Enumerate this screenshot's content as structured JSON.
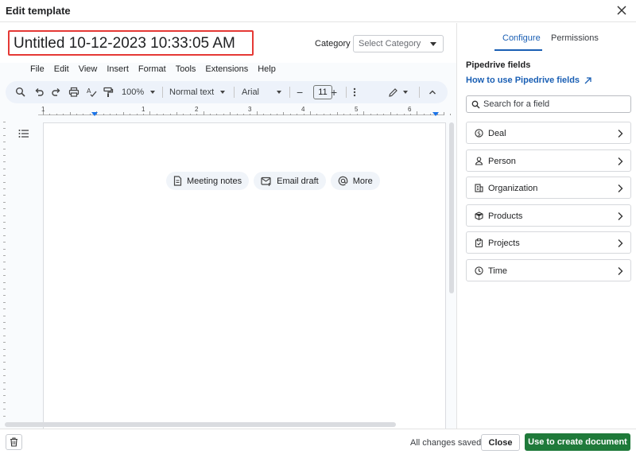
{
  "dialog": {
    "title": "Edit template",
    "close_icon": "close-icon"
  },
  "editor": {
    "document_title": "Untitled 10-12-2023 10:33:05 AM",
    "category_label": "Category",
    "category_placeholder": "Select Category",
    "menu": [
      "File",
      "Edit",
      "View",
      "Insert",
      "Format",
      "Tools",
      "Extensions",
      "Help"
    ],
    "toolbar": {
      "zoom": "100%",
      "style": "Normal text",
      "font": "Arial",
      "font_size": "11",
      "minus": "−",
      "plus": "+"
    },
    "ruler_numbers": [
      "1",
      "1",
      "2",
      "3",
      "4",
      "5",
      "6"
    ],
    "chips": [
      {
        "label": "Meeting notes",
        "icon": "document-icon"
      },
      {
        "label": "Email draft",
        "icon": "email-icon"
      },
      {
        "label": "More",
        "icon": "at-icon"
      }
    ]
  },
  "panel": {
    "tabs": [
      {
        "label": "Configure",
        "active": true
      },
      {
        "label": "Permissions",
        "active": false
      }
    ],
    "section_title": "Pipedrive fields",
    "help_link": "How to use Pipedrive fields",
    "search_placeholder": "Search for a field",
    "fields": [
      {
        "label": "Deal",
        "icon": "dollar-icon"
      },
      {
        "label": "Person",
        "icon": "person-icon"
      },
      {
        "label": "Organization",
        "icon": "building-icon"
      },
      {
        "label": "Products",
        "icon": "box-icon"
      },
      {
        "label": "Projects",
        "icon": "clipboard-icon"
      },
      {
        "label": "Time",
        "icon": "clock-icon"
      }
    ]
  },
  "footer": {
    "status": "All changes saved",
    "close_label": "Close",
    "primary_label": "Use to create document"
  },
  "colors": {
    "accent": "#1a5fb4",
    "primary_button": "#1f7a3a",
    "highlight_border": "#e53935"
  }
}
